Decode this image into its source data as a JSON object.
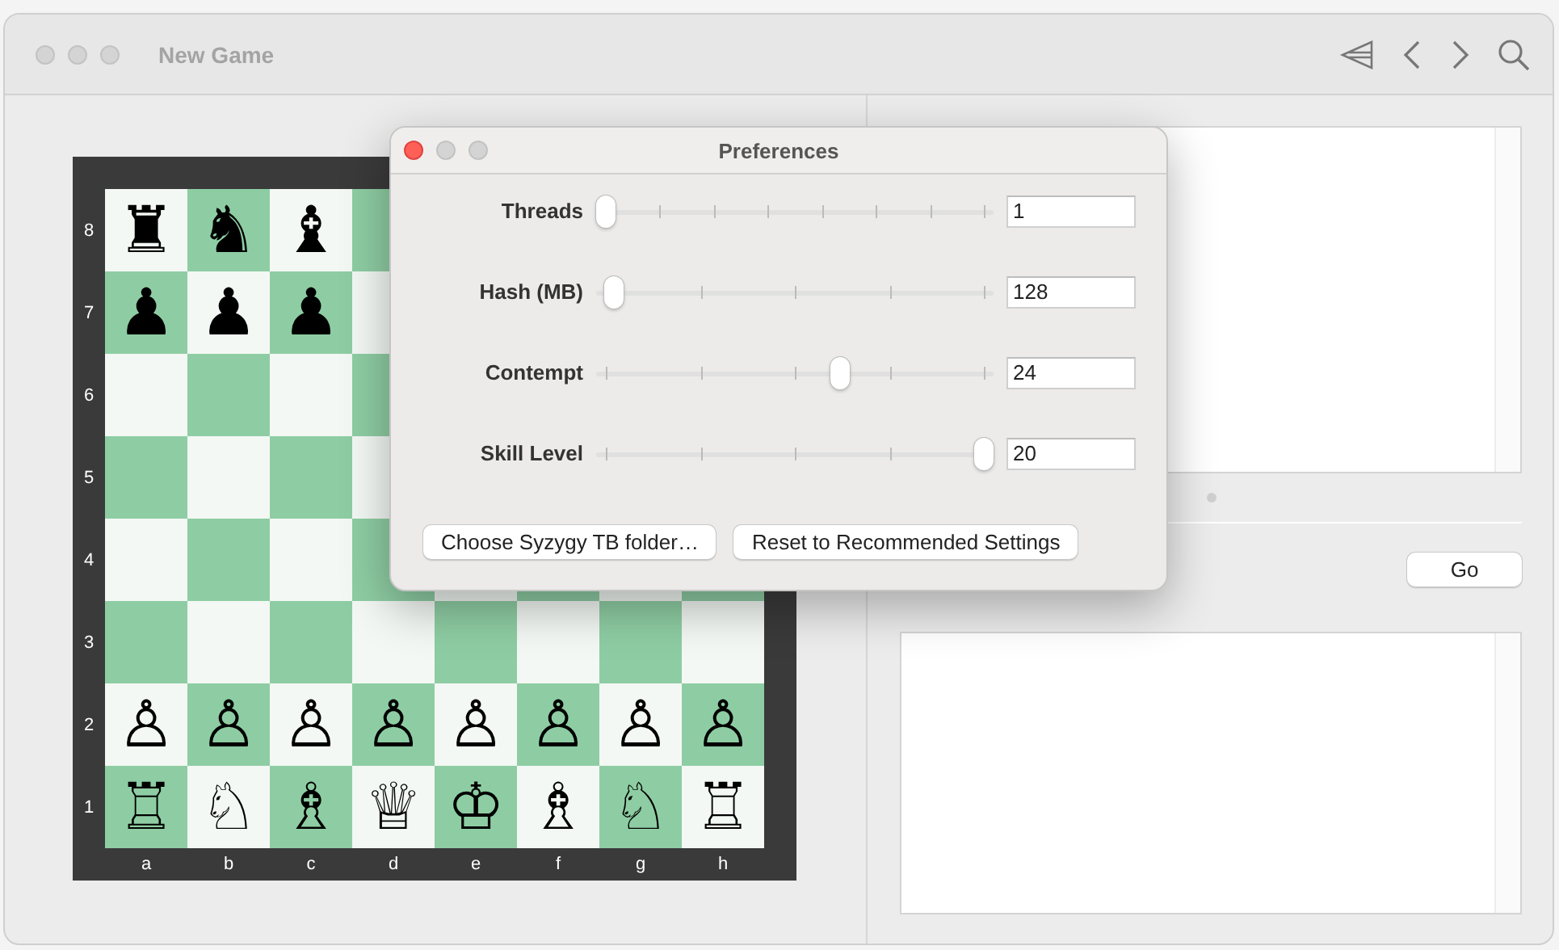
{
  "window": {
    "title": "New Game"
  },
  "board": {
    "ranks": [
      {
        "label": "8",
        "pieces": [
          "♜",
          "♞",
          "♝"
        ]
      },
      {
        "label": "7",
        "pieces": [
          "♟",
          "♟",
          "♟"
        ]
      },
      {
        "label": "6"
      },
      {
        "label": "5"
      },
      {
        "label": "4"
      },
      {
        "label": "3"
      },
      {
        "label": "2",
        "pieces": [
          "♙",
          "♙",
          "♙",
          "♙",
          "♙",
          "♙",
          "♙",
          "♙"
        ]
      },
      {
        "label": "1",
        "pieces": [
          "♖",
          "♘",
          "♗",
          "♕",
          "♔",
          "♗",
          "♘",
          "♖"
        ]
      }
    ],
    "files": [
      "a",
      "b",
      "c",
      "d",
      "e",
      "f",
      "g",
      "h"
    ]
  },
  "analysis": {
    "go_button": "Go"
  },
  "dialog": {
    "title": "Preferences",
    "settings": [
      {
        "label": "Threads",
        "kind": "fine",
        "level": 0,
        "value": "1"
      },
      {
        "label": "Hash (MB)",
        "kind": "coarse",
        "level": 0.02,
        "value": "128"
      },
      {
        "label": "Contempt",
        "kind": "coarse",
        "level": 0.62,
        "value": "24"
      },
      {
        "label": "Skill Level",
        "kind": "coarse",
        "level": 1,
        "value": "20"
      }
    ],
    "buttons": [
      "Choose Syzygy TB folder…",
      "Reset to Recommended Settings"
    ]
  }
}
